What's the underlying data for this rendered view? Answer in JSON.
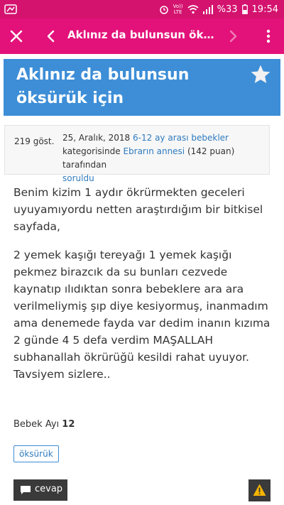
{
  "statusbar": {
    "volte_top": "Vo))",
    "volte_bottom": "LTE",
    "battery": "%33",
    "time": "19:54"
  },
  "appbar": {
    "title": "Aklınız da bulunsun öksürük için-...",
    "icons": [
      "close-icon",
      "back-icon",
      "forward-icon",
      "more-vert-icon"
    ]
  },
  "question": {
    "title": "Aklınız da bulunsun öksürük için",
    "views": "219 göst.",
    "date": "25, Aralık, 2018",
    "category": "6-12 ay arası bebekler",
    "kategori_text": "kategorisinde",
    "author": "Ebrarın annesi",
    "points": "(142 puan)",
    "tarafindan": "tarafından",
    "soruldu": "soruldu",
    "paragraph1": "Benim kizim 1 aydır ökrürmekten geceleri uyuyamıyordu netten araştırdığım bir bitkisel sayfada,",
    "paragraph2": "2 yemek kaşığı tereyağı 1 yemek kaşığı pekmez birazcık da su bunları cezvede kaynatıp ılıdıktan sonra bebeklere ara ara verilmeliymiş şıp diye kesiyormuş, inanmadım ama denemede fayda var dedim inanın kızıma 2 günde 4 5 defa verdim MAŞALLAH subhanallah ökrürüğü kesildi rahat uyuyor. Tavsiyem sizlere..",
    "bebek_label": "Bebek Ayı",
    "bebek_value": "12",
    "tag": "öksürük",
    "reply_label": "cevap"
  },
  "colors": {
    "statusbar": "#d4136f",
    "appbar": "#e3127a",
    "banner": "#3d8ed7",
    "link": "#2f7bbf",
    "button": "#3a3a3a",
    "warning": "#f5b400"
  }
}
